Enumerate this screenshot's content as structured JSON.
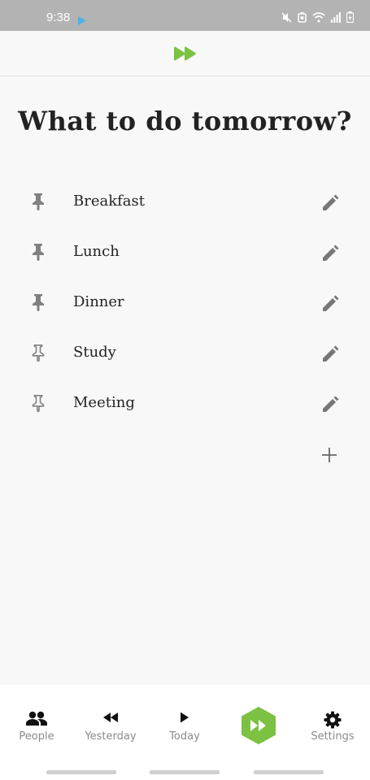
{
  "status_bar": {
    "time": "9:38",
    "icons": [
      "play-indicator-icon",
      "mute-icon",
      "battery-saver-icon",
      "wifi-icon",
      "signal-icon",
      "battery-icon"
    ]
  },
  "header": {
    "logo_icon": "fast-forward-icon",
    "accent_color": "#7cc142"
  },
  "page": {
    "title": "What to do tomorrow?"
  },
  "tasks": [
    {
      "label": "Breakfast",
      "pinned": true
    },
    {
      "label": "Lunch",
      "pinned": true
    },
    {
      "label": "Dinner",
      "pinned": true
    },
    {
      "label": "Study",
      "pinned": false
    },
    {
      "label": "Meeting",
      "pinned": false
    }
  ],
  "actions": {
    "add_icon": "plus-icon",
    "edit_icon": "pencil-icon"
  },
  "bottom_nav": {
    "items": [
      {
        "label": "People",
        "icon": "people-icon"
      },
      {
        "label": "Yesterday",
        "icon": "rewind-icon"
      },
      {
        "label": "Today",
        "icon": "play-icon"
      },
      {
        "label": "",
        "icon": "fast-forward-hexagon-icon",
        "active": true
      },
      {
        "label": "Settings",
        "icon": "gear-icon"
      }
    ]
  }
}
